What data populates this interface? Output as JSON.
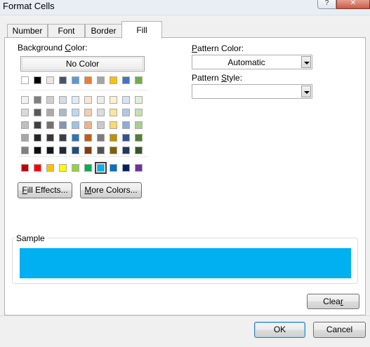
{
  "window": {
    "title": "Format Cells",
    "help_glyph": "?",
    "close_glyph": "✕"
  },
  "tabs": [
    {
      "label": "Number",
      "active": false
    },
    {
      "label": "Font",
      "active": false
    },
    {
      "label": "Border",
      "active": false
    },
    {
      "label": "Fill",
      "active": true
    }
  ],
  "background_color": {
    "label_pre": "Background ",
    "label_key": "C",
    "label_post": "olor:",
    "no_color_label": "No Color",
    "selected_swatch": "#00b0f0",
    "theme_row": [
      "#ffffff",
      "#000000",
      "#e7e6e6",
      "#44546a",
      "#5b9bd5",
      "#ed7d31",
      "#a5a5a5",
      "#ffc000",
      "#4472c4",
      "#70ad47"
    ],
    "tint_rows": [
      [
        "#f2f2f2",
        "#808080",
        "#d0cece",
        "#d6dce4",
        "#deebf6",
        "#fbe5d5",
        "#ededed",
        "#fff2cc",
        "#dae3f3",
        "#e2efd9"
      ],
      [
        "#d9d9d9",
        "#595959",
        "#aeaaaa",
        "#adb9ca",
        "#bdd7ee",
        "#f7cbac",
        "#dbdbdb",
        "#fee599",
        "#b4c6e7",
        "#c5e0b3"
      ],
      [
        "#bfbfbf",
        "#404040",
        "#757171",
        "#8496b0",
        "#9dc3e6",
        "#f4b183",
        "#c9c9c9",
        "#ffd966",
        "#8faadc",
        "#a8d08d"
      ],
      [
        "#a6a6a6",
        "#262626",
        "#3a3838",
        "#333f4f",
        "#2e75b5",
        "#c55a11",
        "#7b7b7b",
        "#bf9000",
        "#2f5496",
        "#538135"
      ],
      [
        "#808080",
        "#0d0d0d",
        "#171616",
        "#222a35",
        "#1f4e79",
        "#843c0b",
        "#525252",
        "#7f6000",
        "#203864",
        "#375623"
      ]
    ],
    "standard_row": [
      "#c00000",
      "#ff0000",
      "#ffc000",
      "#ffff00",
      "#92d050",
      "#00b050",
      "#00b0f0",
      "#0070c0",
      "#002060",
      "#7030a0"
    ]
  },
  "buttons": {
    "fill_effects": {
      "key": "F",
      "rest": "ill Effects..."
    },
    "more_colors": {
      "key": "M",
      "rest": "ore Colors..."
    },
    "clear": {
      "pre": "Clea",
      "key": "r",
      "post": ""
    },
    "ok": "OK",
    "cancel": "Cancel"
  },
  "pattern_color": {
    "label_key": "P",
    "label_rest": "attern Color:",
    "value": "Automatic"
  },
  "pattern_style": {
    "label_pre": "Pattern ",
    "label_key": "S",
    "label_post": "tyle:",
    "value": ""
  },
  "sample": {
    "label": "Sample",
    "fill_color": "#00b0f0"
  }
}
